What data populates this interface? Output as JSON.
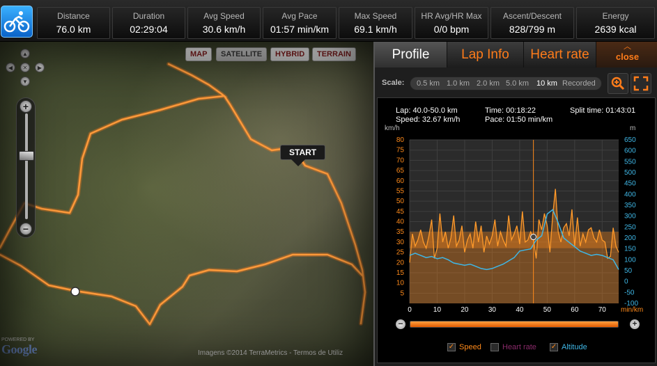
{
  "stats": [
    {
      "label": "Distance",
      "value": "76.0 km"
    },
    {
      "label": "Duration",
      "value": "02:29:04"
    },
    {
      "label": "Avg Speed",
      "value": "30.6 km/h"
    },
    {
      "label": "Avg Pace",
      "value": "01:57 min/km"
    },
    {
      "label": "Max Speed",
      "value": "69.1 km/h"
    },
    {
      "label": "HR Avg/HR Max",
      "value": "0/0 bpm"
    },
    {
      "label": "Ascent/Descent",
      "value": "828/799 m"
    },
    {
      "label": "Energy",
      "value": "2639 kcal"
    }
  ],
  "sport_icon": "bicycle-icon",
  "map": {
    "types": [
      "MAP",
      "SATELLITE",
      "HYBRID",
      "TERRAIN"
    ],
    "active_type": "SATELLITE",
    "start_label": "START",
    "copyright": "Imagens ©2014 TerraMetrics - Termos de Utiliz",
    "powered_by": "POWERED BY",
    "logo": "Google"
  },
  "panel": {
    "tabs": [
      "Profile",
      "Lap Info",
      "Heart rate"
    ],
    "active_tab": "Profile",
    "close_label": "close",
    "scale_label": "Scale:",
    "scales": [
      "0.5 km",
      "1.0 km",
      "2.0 km",
      "5.0 km",
      "10 km",
      "Recorded"
    ],
    "active_scale": "10 km"
  },
  "lap_info": {
    "lap": "Lap: 40.0-50.0 km",
    "speed": "Speed: 32.67 km/h",
    "time": "Time: 00:18:22",
    "pace": "Pace: 01:50 min/km",
    "split": "Split time: 01:43:01"
  },
  "legend": [
    {
      "label": "Speed",
      "checked": true,
      "color": "#ff8a1a"
    },
    {
      "label": "Heart rate",
      "checked": false,
      "color": "#8a2a6a"
    },
    {
      "label": "Altitude",
      "checked": true,
      "color": "#3fb7e6"
    }
  ],
  "chart_data": {
    "type": "line",
    "x_unit": "min/km",
    "x_ticks": [
      0,
      10,
      20,
      30,
      40,
      50,
      60,
      70
    ],
    "left_unit": "km/h",
    "left_ticks": [
      5,
      10,
      15,
      20,
      25,
      30,
      35,
      40,
      45,
      50,
      55,
      60,
      65,
      70,
      75,
      80
    ],
    "right_unit": "m",
    "right_ticks": [
      -100,
      -50,
      0,
      50,
      100,
      150,
      200,
      250,
      300,
      350,
      400,
      450,
      500,
      550,
      600,
      650
    ],
    "xlim": [
      0,
      76
    ],
    "ylim_left": [
      0,
      80
    ],
    "ylim_right": [
      -100,
      650
    ],
    "cursor_x": 45,
    "series": [
      {
        "name": "Speed",
        "axis": "left",
        "x": [
          0,
          1,
          2,
          3,
          4,
          5,
          6,
          7,
          8,
          9,
          10,
          11,
          12,
          13,
          14,
          15,
          16,
          17,
          18,
          19,
          20,
          21,
          22,
          23,
          24,
          25,
          26,
          27,
          28,
          29,
          30,
          31,
          32,
          33,
          34,
          35,
          36,
          37,
          38,
          39,
          40,
          41,
          42,
          43,
          44,
          45,
          46,
          47,
          48,
          49,
          50,
          51,
          52,
          53,
          54,
          55,
          56,
          57,
          58,
          59,
          60,
          61,
          62,
          63,
          64,
          65,
          66,
          67,
          68,
          69,
          70,
          71,
          72,
          73,
          74,
          75,
          76
        ],
        "y": [
          20,
          34,
          28,
          31,
          36,
          30,
          27,
          33,
          41,
          22,
          27,
          44,
          30,
          35,
          27,
          32,
          43,
          28,
          31,
          38,
          25,
          31,
          34,
          27,
          40,
          30,
          38,
          25,
          33,
          29,
          33,
          41,
          28,
          35,
          31,
          28,
          43,
          31,
          34,
          38,
          29,
          45,
          30,
          31,
          35,
          32,
          22,
          41,
          36,
          44,
          38,
          25,
          43,
          56,
          35,
          30,
          37,
          39,
          33,
          46,
          28,
          42,
          28,
          34,
          30,
          36,
          37,
          32,
          30,
          36,
          31,
          30,
          22,
          23,
          37,
          28,
          25
        ],
        "band": [
          27,
          35
        ]
      },
      {
        "name": "Altitude",
        "axis": "right",
        "x": [
          0,
          2,
          4,
          6,
          8,
          10,
          12,
          14,
          16,
          18,
          20,
          22,
          24,
          26,
          28,
          30,
          32,
          34,
          36,
          38,
          40,
          42,
          44,
          46,
          48,
          50,
          52,
          54,
          56,
          58,
          60,
          62,
          64,
          66,
          68,
          70,
          72,
          74,
          76
        ],
        "y": [
          120,
          130,
          120,
          110,
          115,
          105,
          110,
          100,
          85,
          80,
          75,
          80,
          70,
          60,
          55,
          60,
          70,
          80,
          95,
          110,
          140,
          145,
          150,
          190,
          210,
          310,
          330,
          270,
          200,
          180,
          160,
          140,
          130,
          120,
          125,
          120,
          110,
          100,
          55
        ]
      }
    ]
  }
}
